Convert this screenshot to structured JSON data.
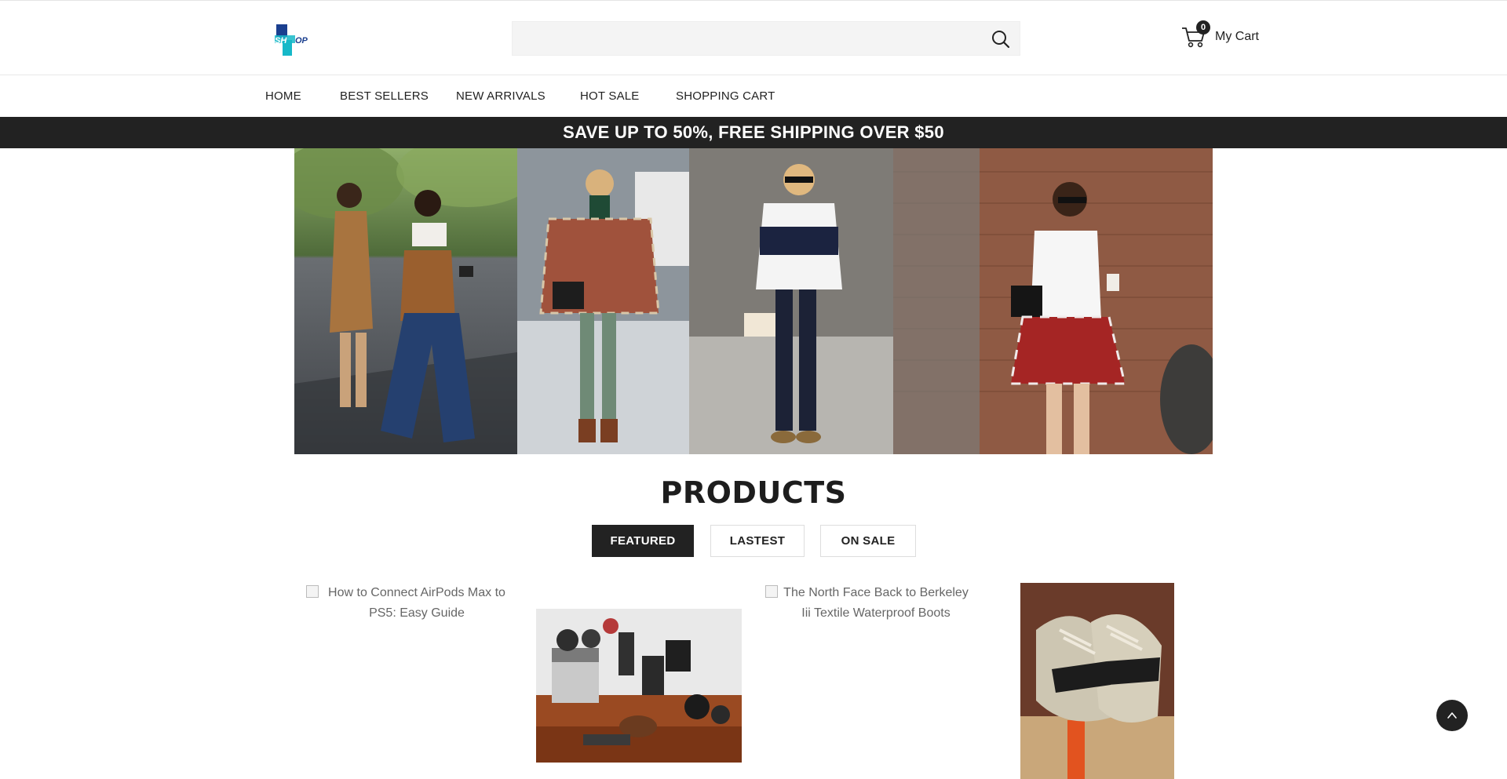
{
  "header": {
    "logo_text": "SHOP",
    "search": {
      "placeholder": "",
      "value": ""
    },
    "cart": {
      "count": "0",
      "label": "My Cart"
    }
  },
  "nav": {
    "items": [
      {
        "label": "HOME"
      },
      {
        "label": "BEST SELLERS"
      },
      {
        "label": "NEW ARRIVALS"
      },
      {
        "label": "HOT SALE"
      },
      {
        "label": "SHOPPING CART"
      }
    ]
  },
  "promo": {
    "text": "SAVE UP TO 50%, FREE SHIPPING OVER $50"
  },
  "hero": {
    "panels": [
      "street-style-photo-1",
      "street-style-photo-2",
      "street-style-photo-3",
      "street-style-photo-4"
    ]
  },
  "products": {
    "title": "PRODUCTS",
    "tabs": [
      {
        "label": "FEATURED",
        "active": true
      },
      {
        "label": "LASTEST",
        "active": false
      },
      {
        "label": "ON SALE",
        "active": false
      }
    ],
    "items": [
      {
        "alt": "How to Connect AirPods Max to PS5: Easy Guide",
        "image_loaded": false
      },
      {
        "alt": "",
        "image_loaded": true
      },
      {
        "alt": "The North Face Back to Berkeley Iii Textile Waterproof Boots",
        "image_loaded": false
      },
      {
        "alt": "",
        "image_loaded": true
      }
    ]
  },
  "colors": {
    "dark": "#222222",
    "logo_blue": "#1a3f8f",
    "logo_cyan": "#16b8c8"
  }
}
